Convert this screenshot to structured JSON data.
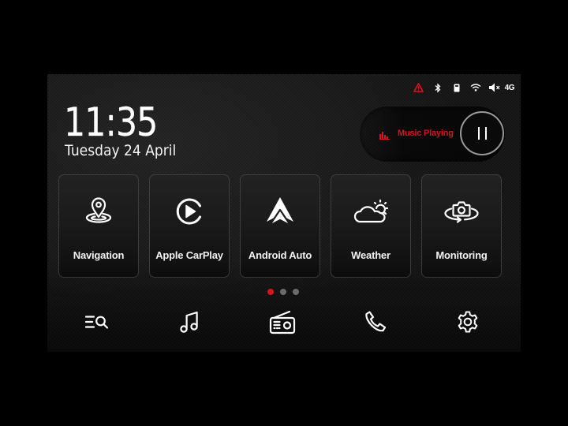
{
  "status_bar": {
    "icons": [
      "warning-icon",
      "bluetooth-icon",
      "usb-icon",
      "wifi-icon",
      "mute-icon"
    ],
    "network": "4G",
    "warning_color": "#d8141c"
  },
  "clock": {
    "time": "11:35",
    "date": "Tuesday 24 April"
  },
  "music_widget": {
    "status": "Music Playing",
    "icon": "equalizer-icon",
    "control": "pause-icon",
    "accent": "#d8141c"
  },
  "tiles": [
    {
      "label": "Navigation",
      "icon": "location-pin-icon"
    },
    {
      "label": "Apple CarPlay",
      "icon": "carplay-icon"
    },
    {
      "label": "Android Auto",
      "icon": "android-auto-icon"
    },
    {
      "label": "Weather",
      "icon": "weather-icon"
    },
    {
      "label": "Monitoring",
      "icon": "camera-360-icon"
    }
  ],
  "pagination": {
    "current": 1,
    "total": 3
  },
  "dock": [
    {
      "name": "menu-search",
      "icon": "list-search-icon"
    },
    {
      "name": "music",
      "icon": "music-note-icon"
    },
    {
      "name": "radio",
      "icon": "radio-icon"
    },
    {
      "name": "phone",
      "icon": "phone-icon"
    },
    {
      "name": "settings",
      "icon": "gear-icon"
    }
  ]
}
